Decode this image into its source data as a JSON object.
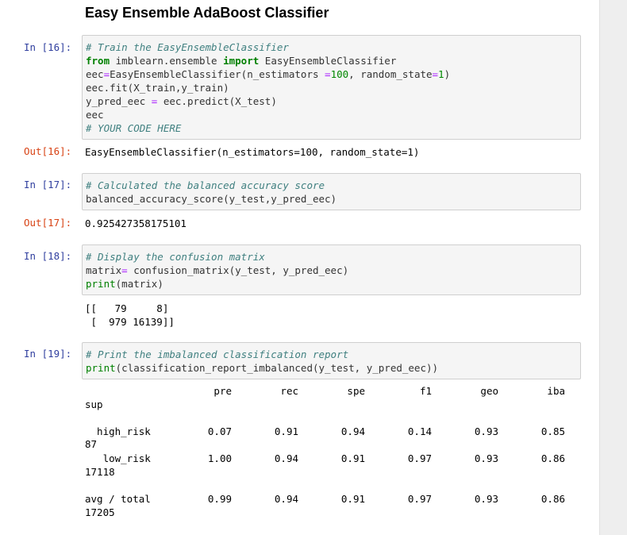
{
  "heading": "Easy Ensemble AdaBoost Classifier",
  "cells": [
    {
      "in_prompt": "In [16]:",
      "lines": [
        "# Train the EasyEnsembleClassifier",
        "from imblearn.ensemble import EasyEnsembleClassifier",
        "eec=EasyEnsembleClassifier(n_estimators =100, random_state=1)",
        "eec.fit(X_train,y_train)",
        "y_pred_eec = eec.predict(X_test)",
        "eec",
        "# YOUR CODE HERE"
      ],
      "out_prompt": "Out[16]:",
      "output": "EasyEnsembleClassifier(n_estimators=100, random_state=1)"
    },
    {
      "in_prompt": "In [17]:",
      "lines": [
        "# Calculated the balanced accuracy score",
        "balanced_accuracy_score(y_test,y_pred_eec)"
      ],
      "out_prompt": "Out[17]:",
      "output": "0.925427358175101"
    },
    {
      "in_prompt": "In [18]:",
      "lines": [
        "# Display the confusion matrix",
        "matrix= confusion_matrix(y_test, y_pred_eec)",
        "print(matrix)"
      ],
      "output_lines": [
        "[[   79     8]",
        " [  979 16139]]"
      ]
    },
    {
      "in_prompt": "In [19]:",
      "lines": [
        "# Print the imbalanced classification report",
        "print(classification_report_imbalanced(y_test, y_pred_eec))"
      ]
    }
  ],
  "report": {
    "headers": [
      "pre",
      "rec",
      "spe",
      "f1",
      "geo",
      "iba"
    ],
    "sup_label": "sup",
    "rows": [
      {
        "label": "  high_risk",
        "support": "87",
        "values": [
          "0.07",
          "0.91",
          "0.94",
          "0.14",
          "0.93",
          "0.85"
        ]
      },
      {
        "label": "   low_risk",
        "support": "17118",
        "values": [
          "1.00",
          "0.94",
          "0.91",
          "0.97",
          "0.93",
          "0.86"
        ]
      },
      {
        "label": "avg / total",
        "support": "17205",
        "values": [
          "0.99",
          "0.94",
          "0.91",
          "0.97",
          "0.93",
          "0.86"
        ]
      }
    ]
  }
}
